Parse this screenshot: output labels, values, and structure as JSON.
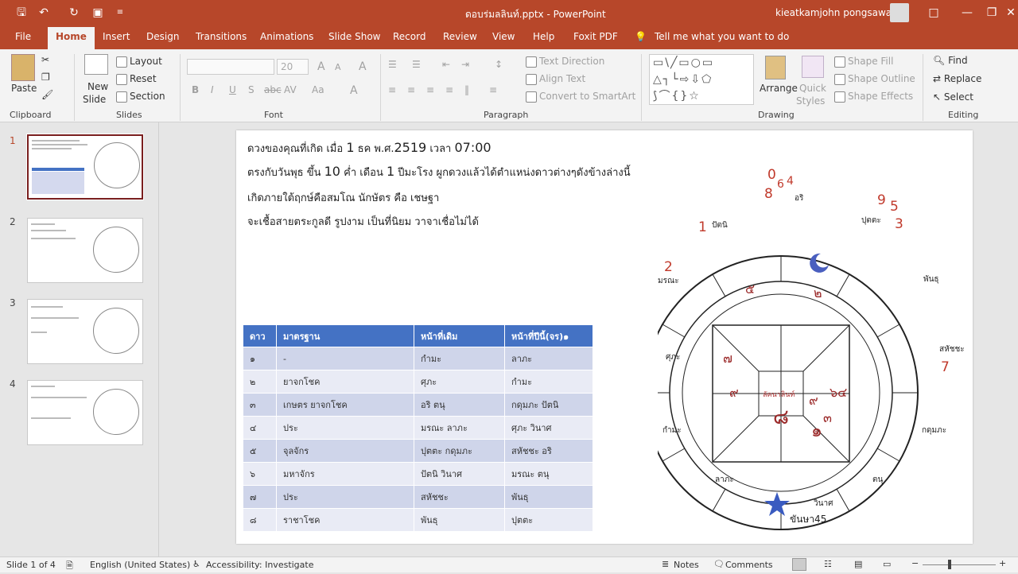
{
  "window": {
    "filename": "ดอบร่มลลินท์.pptx",
    "separator": "-",
    "app": "PowerPoint",
    "user": "kieatkamjohn pongsawad"
  },
  "tabs": [
    "File",
    "Home",
    "Insert",
    "Design",
    "Transitions",
    "Animations",
    "Slide Show",
    "Record",
    "Review",
    "View",
    "Help",
    "Foxit PDF"
  ],
  "tell_me": "Tell me what you want to do",
  "ribbon": {
    "clipboard": {
      "label": "Clipboard",
      "paste": "Paste"
    },
    "slides": {
      "label": "Slides",
      "new_slide": "New",
      "new_slide2": "Slide",
      "layout": "Layout",
      "reset": "Reset",
      "section": "Section"
    },
    "font": {
      "label": "Font",
      "size": "20",
      "bold": "B",
      "italic": "I",
      "underline": "U",
      "shadow": "S",
      "strike": "abc",
      "spacing": "AV",
      "case": "Aa",
      "color": "A",
      "grow": "A",
      "shrink": "A",
      "clear": "A"
    },
    "paragraph": {
      "label": "Paragraph",
      "text_direction": "Text Direction",
      "align_text": "Align Text",
      "smartart": "Convert to SmartArt"
    },
    "drawing": {
      "label": "Drawing",
      "arrange": "Arrange",
      "quick_styles": "Quick",
      "quick_styles2": "Styles",
      "shape_fill": "Shape Fill",
      "shape_outline": "Shape Outline",
      "shape_effects": "Shape Effects"
    },
    "editing": {
      "label": "Editing",
      "find": "Find",
      "replace": "Replace",
      "select": "Select"
    }
  },
  "thumbnails": [
    "1",
    "2",
    "3",
    "4"
  ],
  "slide": {
    "line1_pre": "ดวงของคุณที่เกิด เมื่อ ",
    "line1_day": "1",
    "line1_mid": " ธค พ.ศ.",
    "line1_year": "2519",
    "line1_mid2": " เวลา ",
    "line1_time": "07:00",
    "line2_pre": "ตรงกับวันพุธ ขึ้น ",
    "line2_n1": "10",
    "line2_mid": " ค่ำ เดือน ",
    "line2_n2": "1",
    "line2_post": " ปีมะโรง ผูกดวงแล้วได้ตำแหน่งดาวต่างๆดังข้างล่างนี้",
    "line3": "เกิดภายใต้ฤกษ์คือสมโณ นักษัตร คือ เชษฐา",
    "line4": "จะเชื้อสายตระกูลดี รูปงาม เป็นที่นิยม วาจาเชื่อไม่ได้"
  },
  "table": {
    "headers": [
      "ดาว",
      "มาตรฐาน",
      "หน้าที่เดิม",
      "หน้าที่ปีนี้(จร)๑"
    ],
    "rows": [
      [
        "๑",
        "-",
        "กำมะ",
        "ลาภะ"
      ],
      [
        "๒",
        "ยาจกโชค",
        "ศุภะ",
        "กำมะ"
      ],
      [
        "๓",
        "เกษตร ยาจกโชค",
        "อริ ตนุ",
        "กดุมภะ ปัตนิ"
      ],
      [
        "๔",
        "ประ",
        "มรณะ ลาภะ",
        "ศุภะ วินาศ"
      ],
      [
        "๕",
        "จุลจักร",
        "ปุตตะ กดุมภะ",
        "สหัชชะ อริ"
      ],
      [
        "๖",
        "มหาจักร",
        "ปัตนิ วินาศ",
        "มรณะ ตนุ"
      ],
      [
        "๗",
        "ประ",
        "สหัชชะ",
        "พันธุ"
      ],
      [
        "๘",
        "ราชาโชค",
        "พันธุ",
        "ปุตตะ"
      ]
    ]
  },
  "chart": {
    "center": "ลัคนาลินท์",
    "houses": [
      "๕",
      "๒",
      "๗",
      "๙",
      "๘",
      "๑",
      "๙",
      "๓",
      "๖๔"
    ],
    "outer_labels": [
      "ปัตนิ",
      "มรณะ",
      "ศุภะ",
      "กำมะ",
      "ลาภะ",
      "วินาศ",
      "ตนุ",
      "กดุมภะ",
      "สหัชชะ",
      "พันธุ",
      "ปุตตะ",
      "อริ"
    ],
    "red_numbers": [
      "0",
      "6",
      "4",
      "8",
      "9",
      "5",
      "3",
      "1",
      "2",
      "7"
    ],
    "bottom_label": "ขันษา45"
  },
  "status": {
    "slide_of": "Slide 1 of 4",
    "language": "English (United States)",
    "accessibility": "Accessibility: Investigate",
    "notes": "Notes",
    "comments": "Comments"
  }
}
